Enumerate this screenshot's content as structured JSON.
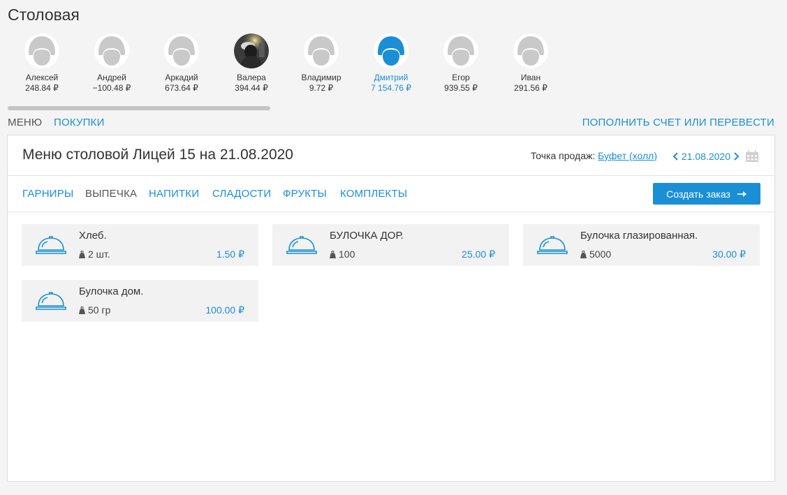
{
  "page": {
    "title": "Столовая"
  },
  "colors": {
    "accent": "#1a8fd6",
    "avatar_default": "#c9c9c9"
  },
  "users": [
    {
      "name": "Алексей",
      "balance": "248.84 ₽",
      "active": false,
      "photo": false
    },
    {
      "name": "Андрей",
      "balance": "−100.48 ₽",
      "active": false,
      "photo": false
    },
    {
      "name": "Аркадий",
      "balance": "673.64 ₽",
      "active": false,
      "photo": false
    },
    {
      "name": "Валера",
      "balance": "394.44 ₽",
      "active": false,
      "photo": true
    },
    {
      "name": "Владимир",
      "balance": "9.72 ₽",
      "active": false,
      "photo": false
    },
    {
      "name": "Дмитрий",
      "balance": "7 154.76 ₽",
      "active": true,
      "photo": false
    },
    {
      "name": "Егор",
      "balance": "939.55 ₽",
      "active": false,
      "photo": false
    },
    {
      "name": "Иван",
      "balance": "291.56 ₽",
      "active": false,
      "photo": false
    }
  ],
  "nav": {
    "menu": "МЕНЮ",
    "purchases": "ПОКУПКИ",
    "topup": "ПОПОЛНИТЬ СЧЕТ ИЛИ ПЕРЕВЕСТИ"
  },
  "menu_panel": {
    "title": "Меню столовой Лицей 15 на 21.08.2020",
    "sale_point_label": "Точка продаж:",
    "sale_point_value": "Буфет (холл)",
    "date": "21.08.2020"
  },
  "categories": [
    {
      "label": "ГАРНИРЫ",
      "active": false
    },
    {
      "label": "ВЫПЕЧКА",
      "active": true
    },
    {
      "label": "НАПИТКИ",
      "active": false
    },
    {
      "label": "СЛАДОСТИ",
      "active": false
    },
    {
      "label": "ФРУКТЫ",
      "active": false
    },
    {
      "label": "КОМПЛЕКТЫ",
      "active": false
    }
  ],
  "create_order": {
    "label": "Создать заказ"
  },
  "products": [
    {
      "name": "Хлеб.",
      "weight": "2 шт.",
      "price": "1.50 ₽"
    },
    {
      "name": "БУЛОЧКА ДОР.",
      "weight": "100",
      "price": "25.00 ₽"
    },
    {
      "name": "Булочка глазированная.",
      "weight": "5000",
      "price": "30.00 ₽"
    },
    {
      "name": "Булочка дом.",
      "weight": "50 гр",
      "price": "100.00 ₽"
    }
  ]
}
